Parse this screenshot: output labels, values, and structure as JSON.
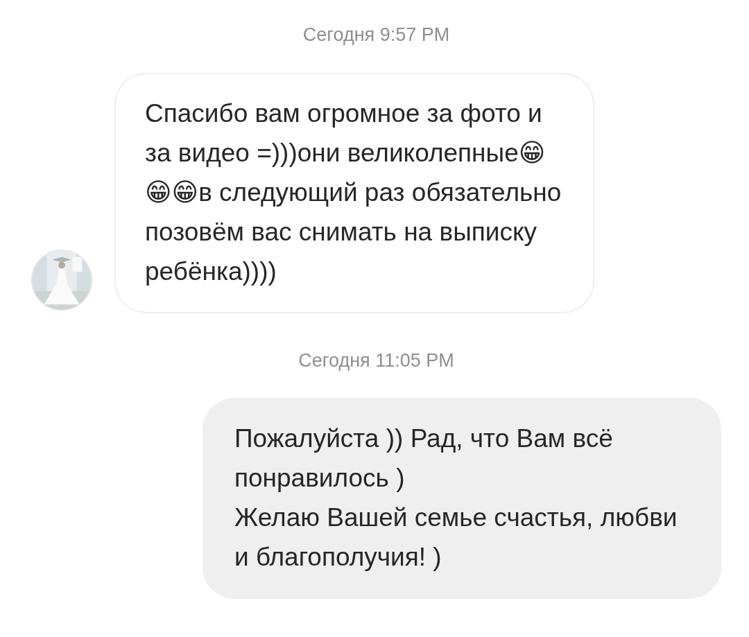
{
  "messages": [
    {
      "kind": "timestamp",
      "text": "Сегодня 9:57 PM"
    },
    {
      "kind": "incoming",
      "avatar": true,
      "text": "Спасибо вам огромное за фото и за видео =)))они великолепные😁😁😁в следующий раз обязательно позовём вас снимать на выписку ребёнка))))"
    },
    {
      "kind": "timestamp",
      "text": "Сегодня 11:05 PM"
    },
    {
      "kind": "outgoing",
      "text": "Пожалуйста )) Рад, что Вам всё понравилось )\nЖелаю Вашей семье счастья, любви и благополучия! )"
    }
  ]
}
